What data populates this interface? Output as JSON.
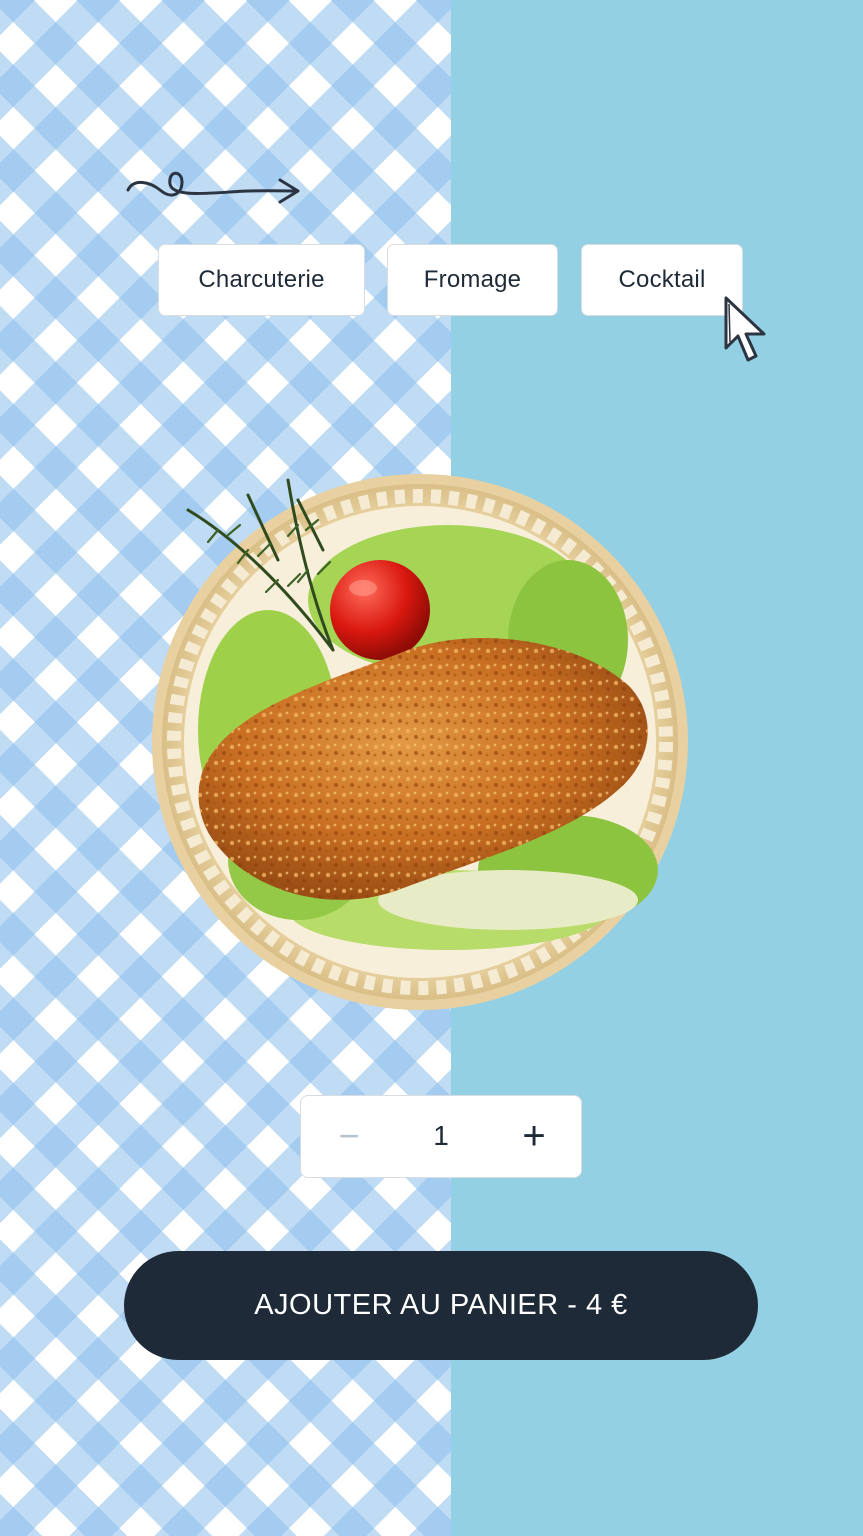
{
  "categories": {
    "items": [
      {
        "label": "Charcuterie"
      },
      {
        "label": "Fromage"
      },
      {
        "label": "Cocktail"
      }
    ]
  },
  "quantity": {
    "decrement_label": "−",
    "value": "1",
    "increment_label": "+"
  },
  "cta": {
    "label": "AJOUTER AU PANIER - 4 €"
  },
  "colors": {
    "background_right": "#94d0e4",
    "gingham_blue": "#8cbeec",
    "button_dark": "#1e2a37",
    "text_dark": "#1f2a37"
  },
  "icons": {
    "decoration": "squiggle-arrow-icon",
    "pointer": "cursor-pointer-icon",
    "product": "breaded-chicken-plate-image"
  }
}
